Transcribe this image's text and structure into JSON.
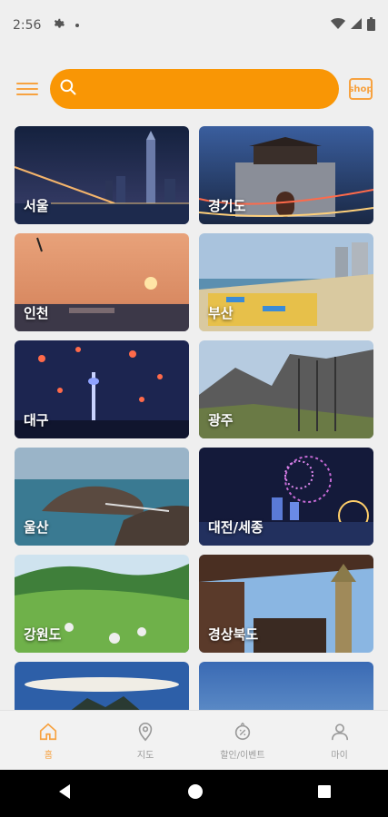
{
  "status_bar": {
    "time": "2:56"
  },
  "header": {
    "search_placeholder": "",
    "shop_label": "shop"
  },
  "regions": [
    {
      "label": "서울"
    },
    {
      "label": "경기도"
    },
    {
      "label": "인천"
    },
    {
      "label": "부산"
    },
    {
      "label": "대구"
    },
    {
      "label": "광주"
    },
    {
      "label": "울산"
    },
    {
      "label": "대전/세종"
    },
    {
      "label": "강원도"
    },
    {
      "label": "경상북도"
    },
    {
      "label": ""
    },
    {
      "label": ""
    }
  ],
  "bottom_nav": {
    "items": [
      {
        "label": "홈",
        "icon": "home-icon",
        "active": true
      },
      {
        "label": "지도",
        "icon": "map-pin-icon",
        "active": false
      },
      {
        "label": "할인/이벤트",
        "icon": "discount-icon",
        "active": false
      },
      {
        "label": "마이",
        "icon": "person-icon",
        "active": false
      }
    ]
  },
  "colors": {
    "accent": "#f99605",
    "accent_light": "#f7a240",
    "nav_inactive": "#9a9a9a",
    "background": "#efefef"
  }
}
